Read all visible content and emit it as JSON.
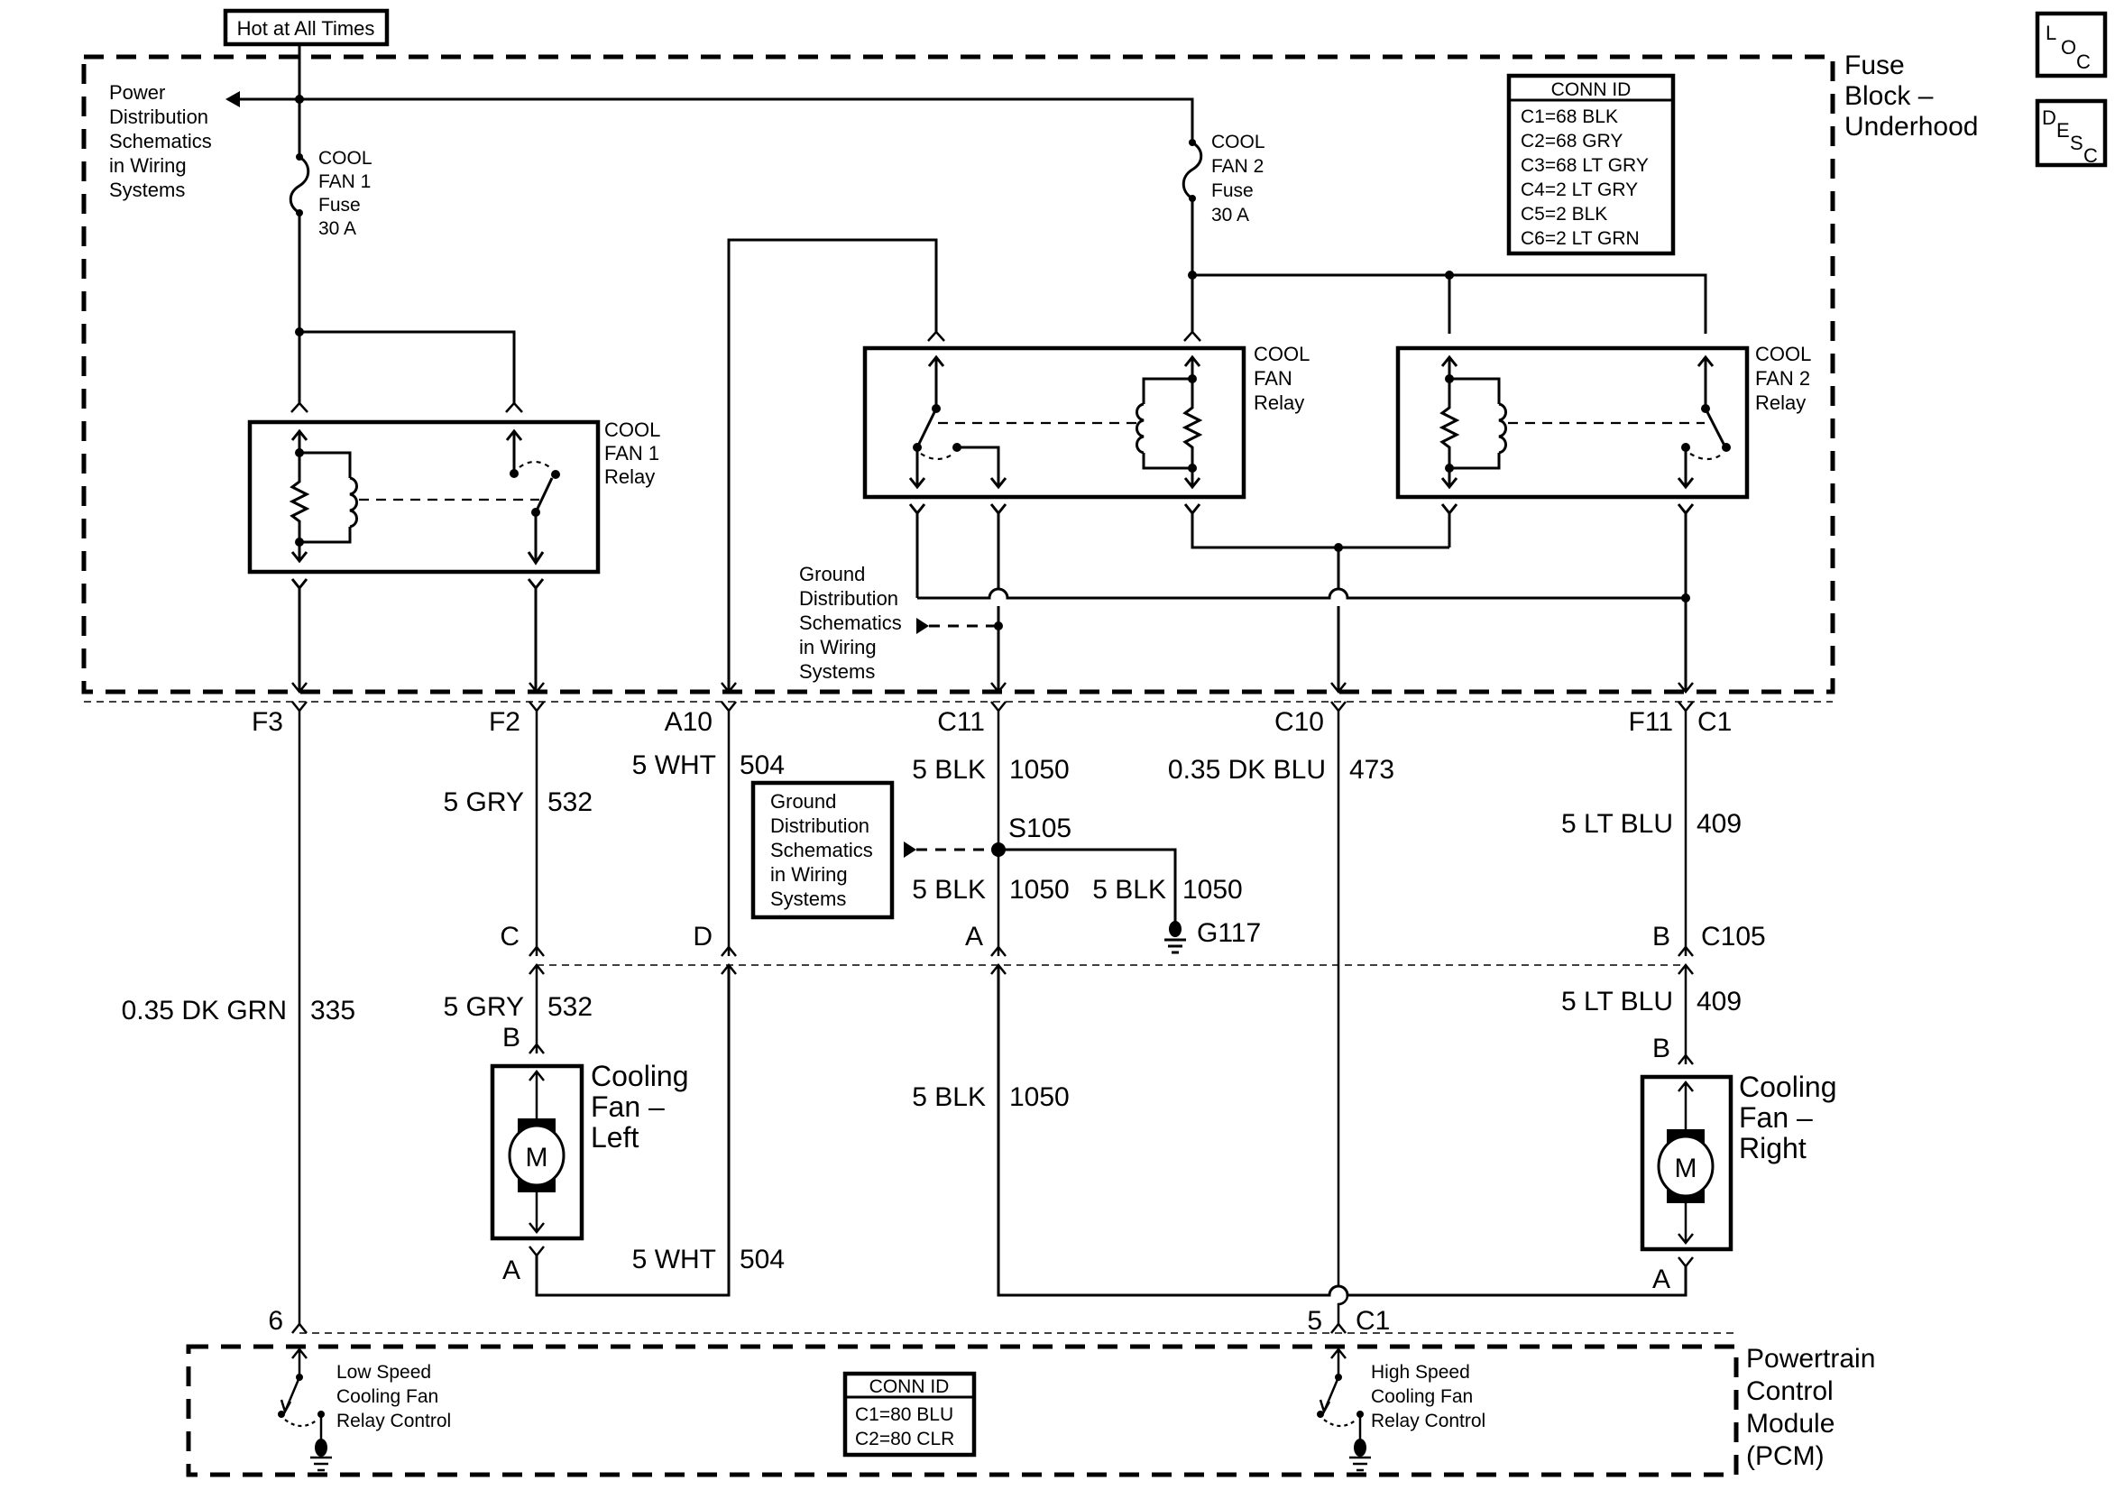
{
  "hot_label": "Hot at All Times",
  "fuse_block": {
    "title": [
      "Fuse",
      "Block –",
      "Underhood"
    ],
    "power_ref": [
      "Power",
      "Distribution",
      "Schematics",
      "in Wiring",
      "Systems"
    ],
    "fuse1": [
      "COOL",
      "FAN 1",
      "Fuse",
      "30 A"
    ],
    "fuse2": [
      "COOL",
      "FAN 2",
      "Fuse",
      "30 A"
    ],
    "relay1": [
      "COOL",
      "FAN 1",
      "Relay"
    ],
    "relay_mid": [
      "COOL",
      "FAN",
      "Relay"
    ],
    "relay2": [
      "COOL",
      "FAN 2",
      "Relay"
    ],
    "ground_ref": [
      "Ground",
      "Distribution",
      "Schematics",
      "in Wiring",
      "Systems"
    ],
    "conn_id": {
      "header": "CONN ID",
      "rows": [
        "C1=68 BLK",
        "C2=68 GRY",
        "C3=68 LT GRY",
        "C4=2 LT GRY",
        "C5=2 BLK",
        "C6=2 LT GRN"
      ]
    },
    "pins": {
      "f3": "F3",
      "f2": "F2",
      "a10": "A10",
      "c11": "C11",
      "c10": "C10",
      "f11": "F11",
      "c1": "C1"
    }
  },
  "nav_buttons": {
    "loc": [
      "L",
      "O",
      "C"
    ],
    "desc": [
      "D",
      "E",
      "S",
      "C"
    ]
  },
  "wires": {
    "wht_504_top": {
      "color": "5 WHT",
      "circuit": "504"
    },
    "gry_532_top": {
      "color": "5 GRY",
      "circuit": "532"
    },
    "blk_1050_top": {
      "color": "5 BLK",
      "circuit": "1050"
    },
    "dkblu_473": {
      "color": "0.35 DK BLU",
      "circuit": "473"
    },
    "ltblu_409_top": {
      "color": "5 LT BLU",
      "circuit": "409"
    },
    "blk_1050_s105_a": {
      "color": "5 BLK",
      "circuit": "1050"
    },
    "blk_1050_s105_b": {
      "color": "5 BLK",
      "circuit": "1050"
    },
    "dkgrn_335": {
      "color": "0.35 DK GRN",
      "circuit": "335"
    },
    "gry_532_bot": {
      "color": "5 GRY",
      "circuit": "532"
    },
    "ltblu_409_bot": {
      "color": "5 LT BLU",
      "circuit": "409"
    },
    "blk_1050_bot": {
      "color": "5 BLK",
      "circuit": "1050"
    },
    "wht_504_bot": {
      "color": "5 WHT",
      "circuit": "504"
    }
  },
  "splice": "S105",
  "ground": "G117",
  "ground_box": [
    "Ground",
    "Distribution",
    "Schematics",
    "in Wiring",
    "Systems"
  ],
  "c105": {
    "c": "C",
    "d": "D",
    "a": "A",
    "b": "B",
    "name": "C105"
  },
  "fan_left": {
    "label": [
      "Cooling",
      "Fan –",
      "Left"
    ],
    "pin_b": "B",
    "pin_a": "A",
    "motor": "M"
  },
  "fan_right": {
    "label": [
      "Cooling",
      "Fan –",
      "Right"
    ],
    "pin_b": "B",
    "pin_a": "A",
    "motor": "M"
  },
  "pcm": {
    "title": [
      "Powertrain",
      "Control",
      "Module",
      "(PCM)"
    ],
    "pin6": "6",
    "pin5": "5",
    "conn": "C1",
    "low_speed": [
      "Low Speed",
      "Cooling Fan",
      "Relay Control"
    ],
    "high_speed": [
      "High Speed",
      "Cooling Fan",
      "Relay Control"
    ],
    "conn_id": {
      "header": "CONN ID",
      "rows": [
        "C1=80 BLU",
        "C2=80 CLR"
      ]
    }
  }
}
